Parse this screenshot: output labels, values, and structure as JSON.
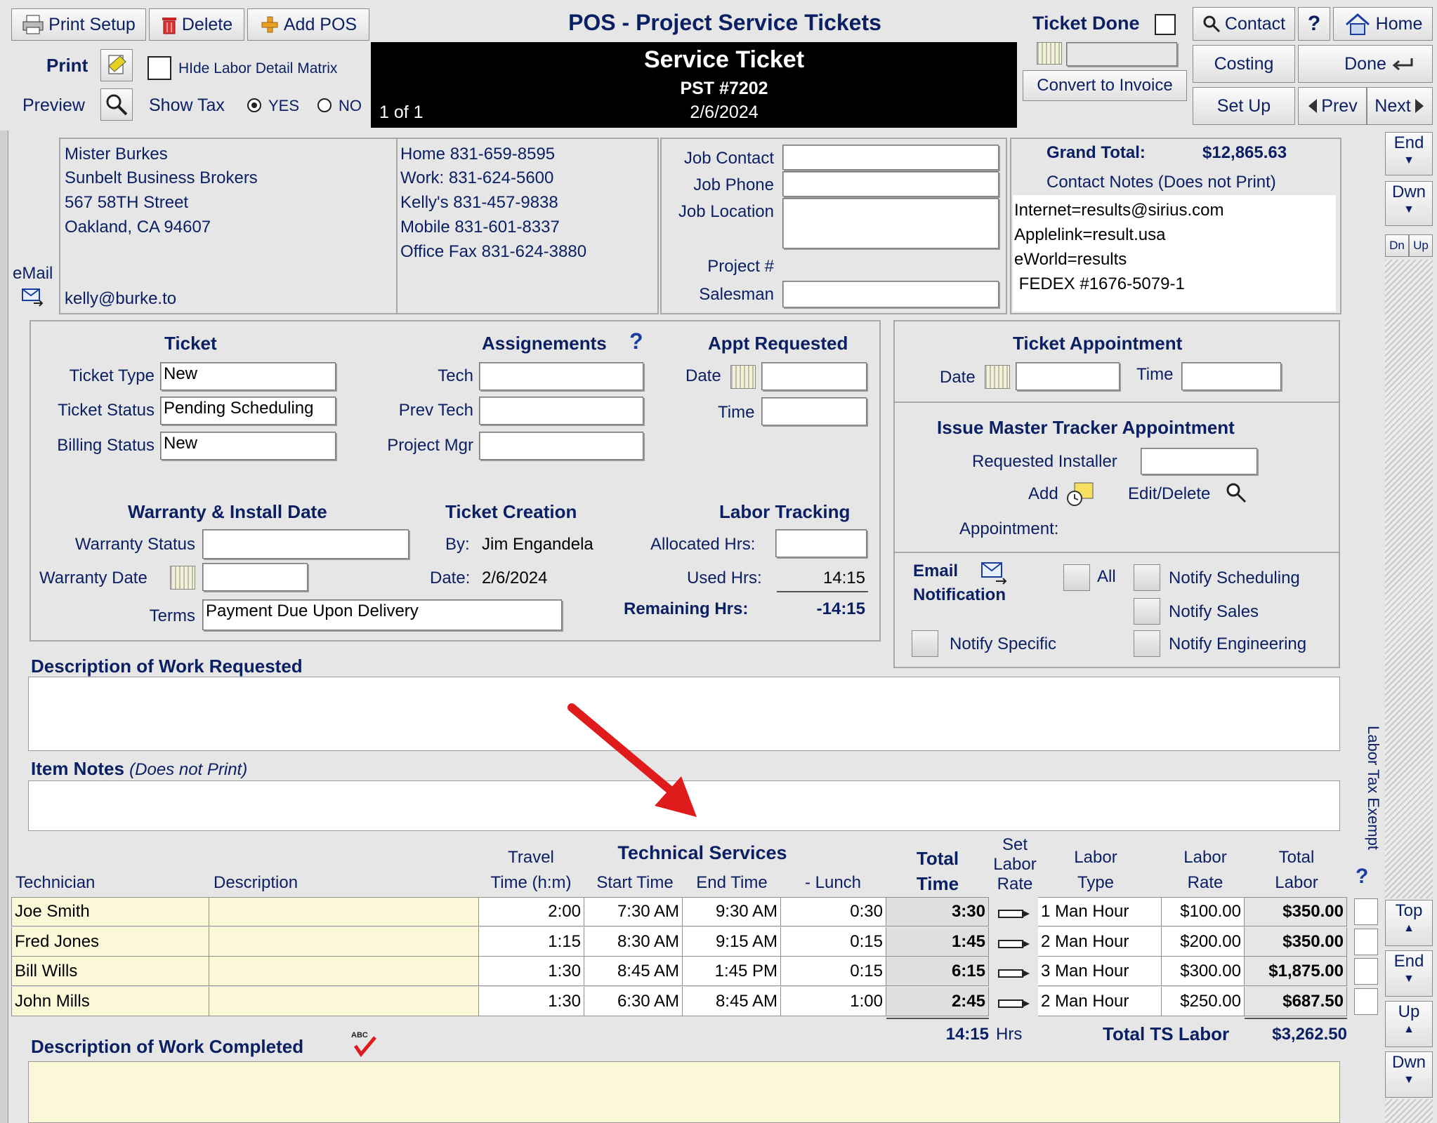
{
  "toolbar": {
    "print_setup": "Print Setup",
    "delete": "Delete",
    "add_pos": "Add POS",
    "print": "Print",
    "preview": "Preview",
    "hide_labor": "HIde Labor Detail Matrix",
    "show_tax": "Show Tax",
    "yes": "YES",
    "no": "NO",
    "ticket_done": "Ticket Done",
    "convert": "Convert to Invoice",
    "contact": "Contact",
    "help": "?",
    "home": "Home",
    "costing": "Costing",
    "done": "Done",
    "setup": "Set Up",
    "prev": "Prev",
    "next": "Next"
  },
  "header": {
    "title": "POS - Project Service Tickets",
    "subtitle": "Service Ticket",
    "ticket_no": "PST #7202",
    "date": "2/6/2024",
    "record_count": "1 of 1"
  },
  "customer": {
    "name": "Mister Burkes",
    "company": "Sunbelt Business Brokers",
    "street": "567 58TH Street",
    "city": "Oakland, CA 94607",
    "email_label": "eMail",
    "email": "kelly@burke.to",
    "phones": [
      "Home 831-659-8595",
      "Work: 831-624-5600",
      "Kelly's 831-457-9838",
      "Mobile 831-601-8337",
      "Office Fax 831-624-3880"
    ]
  },
  "job": {
    "contact_label": "Job Contact",
    "phone_label": "Job Phone",
    "location_label": "Job Location",
    "project_label": "Project #",
    "salesman_label": "Salesman"
  },
  "summary": {
    "grand_total_label": "Grand Total:",
    "grand_total": "$12,865.63",
    "notes_label": "Contact Notes (Does not Print)",
    "notes": [
      "Internet=results@sirius.com",
      "Applelink=result.usa",
      "eWorld=results",
      " FEDEX #1676-5079-1"
    ]
  },
  "ticket": {
    "heading": "Ticket",
    "type_label": "Ticket Type",
    "type": "New",
    "status_label": "Ticket Status",
    "status": "Pending Scheduling",
    "billing_label": "Billing Status",
    "billing": "New",
    "assign_heading": "Assignements",
    "tech_label": "Tech",
    "prev_tech_label": "Prev Tech",
    "pm_label": "Project Mgr",
    "appt_heading": "Appt Requested",
    "date_label": "Date",
    "time_label": "Time",
    "warranty_heading": "Warranty & Install Date",
    "warranty_status_label": "Warranty Status",
    "warranty_date_label": "Warranty Date",
    "terms_label": "Terms",
    "terms": "Payment Due Upon Delivery",
    "creation_heading": "Ticket Creation",
    "by_label": "By:",
    "by": "Jim Engandela",
    "created_label": "Date:",
    "created": "2/6/2024",
    "labor_heading": "Labor Tracking",
    "allocated_label": "Allocated Hrs:",
    "used_label": "Used Hrs:",
    "used": "14:15",
    "remaining_label": "Remaining Hrs:",
    "remaining": "-14:15"
  },
  "appointment": {
    "heading": "Ticket Appointment",
    "date_label": "Date",
    "time_label": "Time",
    "tracker_heading": "Issue Master Tracker Appointment",
    "installer_label": "Requested Installer",
    "add_label": "Add",
    "edit_label": "Edit/Delete",
    "appt_label": "Appointment:"
  },
  "notify": {
    "email_label": "Email",
    "notification_label": "Notification",
    "all": "All",
    "scheduling": "Notify Scheduling",
    "sales": "Notify Sales",
    "engineering": "Notify Engineering",
    "specific": "Notify Specific"
  },
  "sections": {
    "work_requested": "Description of Work Requested",
    "item_notes": "Item Notes",
    "item_notes_note": "(Does not Print)",
    "work_completed": "Description of Work Completed",
    "labor_tax_exempt": "Labor Tax Exempt"
  },
  "labor": {
    "group_heading": "Technical Services",
    "col_technician": "Technician",
    "col_description": "Description",
    "col_travel_1": "Travel",
    "col_travel_2": "Time (h:m)",
    "col_start": "Start Time",
    "col_end": "End Time",
    "col_lunch": "- Lunch",
    "col_total_1": "Total",
    "col_total_2": "Time",
    "col_set_1": "Set",
    "col_set_2": "Labor",
    "col_set_3": "Rate",
    "col_type_1": "Labor",
    "col_type_2": "Type",
    "col_rate_1": "Labor",
    "col_rate_2": "Rate",
    "col_tl_1": "Total",
    "col_tl_2": "Labor",
    "rows": [
      {
        "tech": "Joe Smith",
        "desc": "",
        "travel": "2:00",
        "start": "7:30 AM",
        "end": "9:30 AM",
        "lunch": "0:30",
        "total": "3:30",
        "type": "1 Man Hour",
        "rate": "$100.00",
        "labor": "$350.00"
      },
      {
        "tech": "Fred Jones",
        "desc": "",
        "travel": "1:15",
        "start": "8:30 AM",
        "end": "9:15 AM",
        "lunch": "0:15",
        "total": "1:45",
        "type": "2 Man Hour",
        "rate": "$200.00",
        "labor": "$350.00"
      },
      {
        "tech": "Bill Wills",
        "desc": "",
        "travel": "1:30",
        "start": "8:45 AM",
        "end": "1:45 PM",
        "lunch": "0:15",
        "total": "6:15",
        "type": "3 Man Hour",
        "rate": "$300.00",
        "labor": "$1,875.00"
      },
      {
        "tech": "John Mills",
        "desc": "",
        "travel": "1:30",
        "start": "6:30 AM",
        "end": "8:45 AM",
        "lunch": "1:00",
        "total": "2:45",
        "type": "2 Man Hour",
        "rate": "$250.00",
        "labor": "$687.50"
      }
    ],
    "total_hours": "14:15",
    "hrs_label": "Hrs",
    "total_label": "Total TS Labor",
    "total_labor": "$3,262.50"
  },
  "scroll": {
    "end": "End",
    "dwn": "Dwn",
    "dn": "Dn",
    "up_small": "Up",
    "top": "Top",
    "up": "Up"
  },
  "colors": {
    "navy": "#0b1f63",
    "cream": "#fbf8d8",
    "arrow": "#e01b1b"
  }
}
